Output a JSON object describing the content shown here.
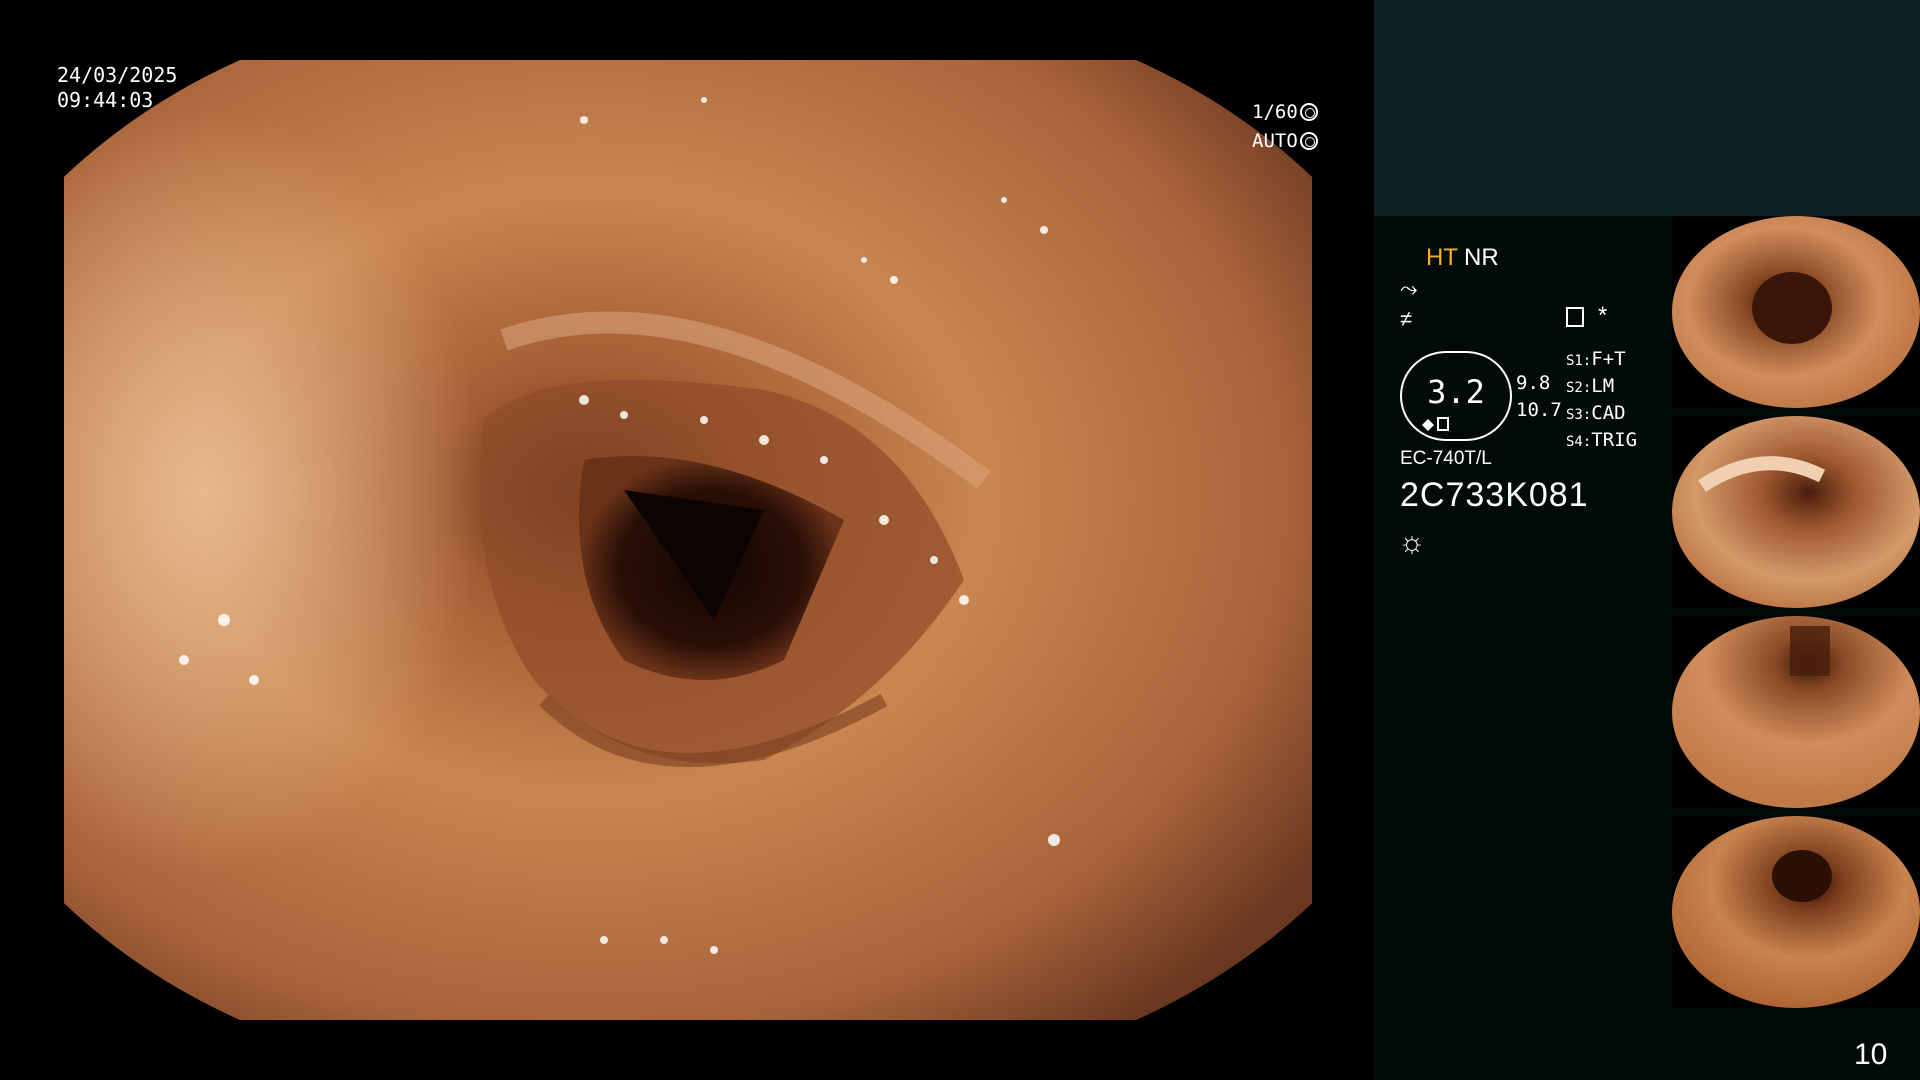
{
  "overlay": {
    "date": "24/03/2025",
    "time": "09:44:03",
    "shutter": "1/60",
    "iris": "AUTO"
  },
  "panel": {
    "ht": "HT",
    "nr": "NR",
    "gauge_value": "3.2",
    "value_a": "9.8",
    "value_b": "10.7",
    "switches": [
      {
        "key": "S1:",
        "value": "F+T"
      },
      {
        "key": "S2:",
        "value": "LM"
      },
      {
        "key": "S3:",
        "value": "CAD"
      },
      {
        "key": "S4:",
        "value": "TRIG"
      }
    ],
    "star": "*",
    "model": "EC-740T/L",
    "serial": "2C733K081",
    "page_number": "10"
  },
  "icons": [
    "spark-icon",
    "lightning-icon",
    "image-icon",
    "brightness-icon",
    "shutter-icon"
  ],
  "colors": {
    "ht": "#f0b020",
    "panel_bg": "#0c2226",
    "tissue": "#c98650"
  }
}
